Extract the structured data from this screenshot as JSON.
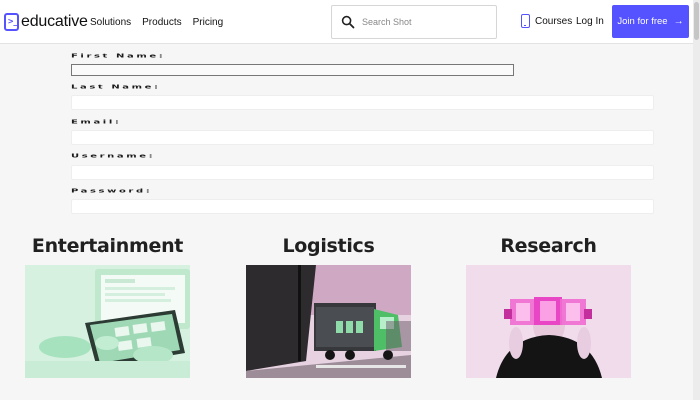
{
  "header": {
    "logo_text": "educative",
    "nav": [
      "Solutions",
      "Products",
      "Pricing"
    ],
    "search_placeholder": "Search Shot",
    "courses_label": "Courses",
    "login_label": "Log In",
    "join_label": "Join for free",
    "join_arrow": "→"
  },
  "form": {
    "fields": [
      {
        "label": "First Name:",
        "value": ""
      },
      {
        "label": "Last Name:",
        "value": ""
      },
      {
        "label": "Email:",
        "value": ""
      },
      {
        "label": "Username:",
        "value": ""
      },
      {
        "label": "Password:",
        "value": ""
      }
    ]
  },
  "cards": [
    {
      "title": "Entertainment"
    },
    {
      "title": "Logistics"
    },
    {
      "title": "Research"
    }
  ],
  "colors": {
    "brand": "#5553ff",
    "image_tint_green": "#8ee7b4",
    "image_tint_pink": "#f06bd2"
  }
}
